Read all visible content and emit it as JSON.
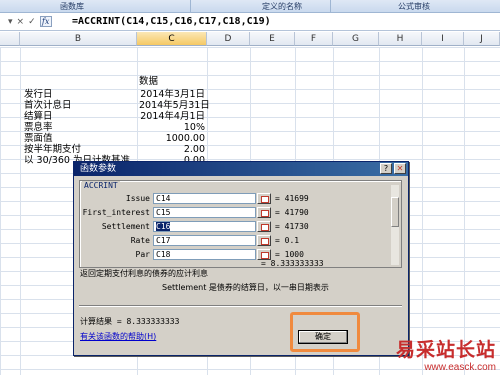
{
  "ribbon": {
    "groups": [
      "函数库",
      "定义的名称",
      "公式审核"
    ]
  },
  "formula_bar": {
    "buttons": [
      "▾",
      "×",
      "✓"
    ],
    "fx": "fx",
    "formula": "=ACCRINT(C14,C15,C16,C17,C18,C19)"
  },
  "columns": [
    "B",
    "C",
    "D",
    "E",
    "F",
    "G",
    "H",
    "I",
    "J"
  ],
  "sheet": {
    "header_label": "数据",
    "rows": [
      {
        "label": "发行日",
        "value": "2014年3月1日"
      },
      {
        "label": "首次计息日",
        "value": "2014年5月31日"
      },
      {
        "label": "结算日",
        "value": "2014年4月1日"
      },
      {
        "label": "票息率",
        "value": "10%"
      },
      {
        "label": "票面值",
        "value": "1000.00"
      },
      {
        "label": "按半年期支付",
        "value": "2.00"
      },
      {
        "label": "以 30/360 为日计数基准",
        "value": "0.00"
      }
    ]
  },
  "dialog": {
    "title": "函数参数",
    "function_name": "ACCRINT",
    "args": [
      {
        "name": "Issue",
        "ref": "C14",
        "result": "= 41699"
      },
      {
        "name": "First_interest",
        "ref": "C15",
        "result": "= 41790"
      },
      {
        "name": "Settlement",
        "ref": "C16",
        "result": "= 41730"
      },
      {
        "name": "Rate",
        "ref": "C17",
        "result": "= 0.1"
      },
      {
        "name": "Par",
        "ref": "C18",
        "result": "= 1000"
      }
    ],
    "overall_result": "= 8.333333333",
    "description": "返回定期支付利息的债券的应计利息",
    "arg_help": "Settlement  是债券的结算日，以一串日期表示",
    "calc_result": "计算结果 = 8.333333333",
    "help_link": "有关该函数的帮助(H)",
    "ok_label": "确定"
  },
  "watermark": {
    "title": "易采站长站",
    "url": "www.easck.com"
  },
  "colors": {
    "highlight": "#f08a3e",
    "titlebar": "#0a246a",
    "watermark": "#c72d2d"
  }
}
